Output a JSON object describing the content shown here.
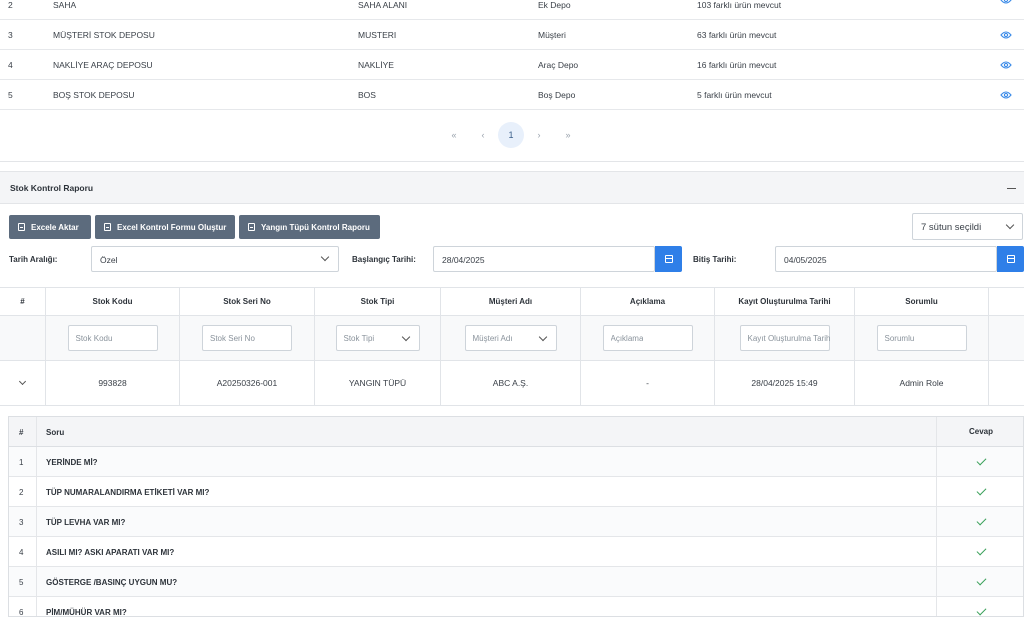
{
  "warehouses": [
    {
      "no": "2",
      "name": "SAHA",
      "code": "SAHA ALANI",
      "type": "Ek Depo",
      "stock": "103 farklı ürün mevcut"
    },
    {
      "no": "3",
      "name": "MÜŞTERİ STOK DEPOSU",
      "code": "MUSTERI",
      "type": "Müşteri",
      "stock": "63 farklı ürün mevcut"
    },
    {
      "no": "4",
      "name": "NAKLİYE ARAÇ DEPOSU",
      "code": "NAKLİYE",
      "type": "Araç Depo",
      "stock": "16 farklı ürün mevcut"
    },
    {
      "no": "5",
      "name": "BOŞ STOK DEPOSU",
      "code": "BOS",
      "type": "Boş Depo",
      "stock": "5 farklı ürün mevcut"
    }
  ],
  "pagination": {
    "first": "«",
    "prev": "‹",
    "current": "1",
    "next": "›",
    "last": "»"
  },
  "panel": {
    "title": "Stok Kontrol Raporu"
  },
  "toolbar": {
    "export_excel": "Excele Aktar",
    "excel_form": "Excel Kontrol Formu Oluştur",
    "fire_report": "Yangın Tüpü Kontrol Raporu",
    "columns_selected": "7 sütun seçildi"
  },
  "filters": {
    "range_label": "Tarih Aralığı:",
    "range_value": "Özel",
    "start_label": "Başlangıç Tarihi:",
    "start_value": "28/04/2025",
    "end_label": "Bitiş Tarihi:",
    "end_value": "04/05/2025"
  },
  "grid": {
    "headers": [
      "#",
      "Stok Kodu",
      "Stok Seri No",
      "Stok Tipi",
      "Müşteri Adı",
      "Açıklama",
      "Kayıt Oluşturulma Tarihi",
      "Sorumlu"
    ],
    "filter_placeholders": [
      "Stok Kodu",
      "Stok Seri No",
      "Stok Tipi",
      "Müşteri Adı",
      "Açıklama",
      "Kayıt Oluşturulma Tarihi",
      "Sorumlu"
    ],
    "row": {
      "code": "993828",
      "serial": "A20250326-001",
      "type": "YANGIN TÜPÜ",
      "customer": "ABC A.Ş.",
      "desc": "-",
      "date": "28/04/2025 15:49",
      "owner": "Admin Role"
    }
  },
  "questions": {
    "headers": {
      "no": "#",
      "question": "Soru",
      "answer": "Cevap"
    },
    "rows": [
      {
        "no": "1",
        "text": "YERİNDE Mİ?"
      },
      {
        "no": "2",
        "text": "TÜP NUMARALANDIRMA ETİKETİ VAR MI?"
      },
      {
        "no": "3",
        "text": "TÜP LEVHA VAR MI?"
      },
      {
        "no": "4",
        "text": "ASILI MI? ASKI APARATI VAR MI?"
      },
      {
        "no": "5",
        "text": "GÖSTERGE /BASINÇ UYGUN MU?"
      },
      {
        "no": "6",
        "text": "PİM/MÜHÜR VAR MI?"
      }
    ]
  }
}
